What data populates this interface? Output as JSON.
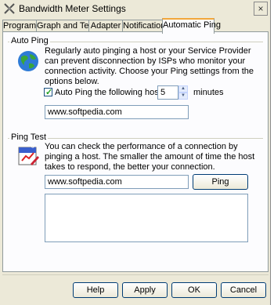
{
  "window": {
    "title": "Bandwidth Meter Settings",
    "close_label": "×"
  },
  "tabs": [
    {
      "label": "Program"
    },
    {
      "label": "Graph and Text"
    },
    {
      "label": "Adapter"
    },
    {
      "label": "Notification"
    },
    {
      "label": "Automatic Ping"
    }
  ],
  "auto_ping": {
    "group_label": "Auto Ping",
    "description": "Regularly auto pinging a host or your Service Provider can prevent disconnection by ISPs who monitor your connection activity.  Choose your Ping settings from the options below.",
    "checkbox_label": "Auto Ping the following host every",
    "checked": true,
    "interval_value": "5",
    "interval_unit": "minutes",
    "host_value": "www.softpedia.com"
  },
  "ping_test": {
    "group_label": "Ping Test",
    "icon_text": "Ping",
    "description": "You can check the performance of a connection by pinging a host. The smaller the amount of time the host takes to respond, the better your connection.",
    "host_value": "www.softpedia.com",
    "ping_button": "Ping",
    "results": ""
  },
  "buttons": {
    "help": "Help",
    "apply": "Apply",
    "ok": "OK",
    "cancel": "Cancel"
  },
  "colors": {
    "window_bg": "#ece9d8",
    "active_tab_accent": "#f2a73c",
    "checkmark": "#21a121"
  }
}
